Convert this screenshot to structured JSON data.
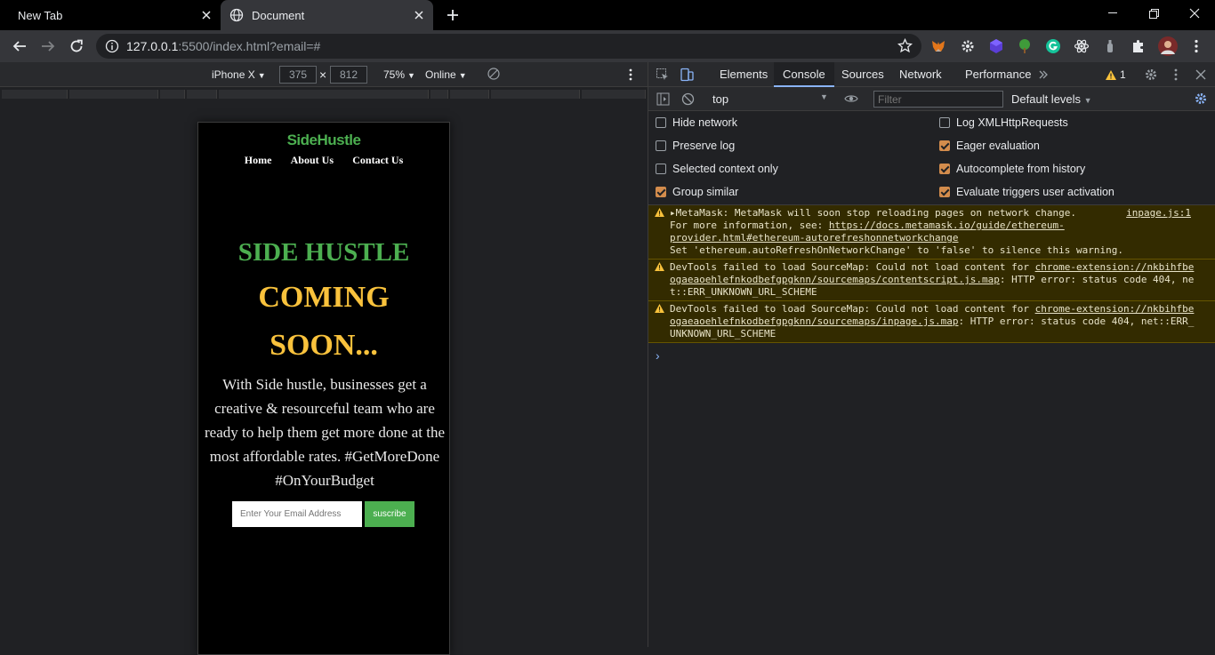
{
  "tabs": [
    {
      "title": "New Tab"
    },
    {
      "title": "Document"
    }
  ],
  "omnibox": {
    "url_host": "127.0.0.1",
    "url_rest": ":5500/index.html?email=#"
  },
  "device_toolbar": {
    "device": "iPhone X",
    "width": "375",
    "height": "812",
    "zoom": "75%",
    "network": "Online"
  },
  "site": {
    "logo": "SideHustle",
    "nav": [
      "Home",
      "About Us",
      "Contact Us"
    ],
    "hero_title": "SIDE HUSTLE",
    "hero_sub1": "COMING",
    "hero_sub2": "SOON...",
    "description": "With Side hustle, businesses get a creative & resourceful team who are ready to help them get more done at the most affordable rates. #GetMoreDone #OnYourBudget",
    "email_placeholder": "Enter Your Email Address",
    "subscribe_label": "suscribe"
  },
  "devtools": {
    "tabs": [
      "Elements",
      "Console",
      "Sources",
      "Network",
      "Performance"
    ],
    "active_tab": "Console",
    "warning_count": "1",
    "context": "top",
    "filter_placeholder": "Filter",
    "levels": "Default levels",
    "settings_left": [
      {
        "label": "Hide network",
        "checked": false
      },
      {
        "label": "Preserve log",
        "checked": false
      },
      {
        "label": "Selected context only",
        "checked": false
      },
      {
        "label": "Group similar",
        "checked": true
      }
    ],
    "settings_right": [
      {
        "label": "Log XMLHttpRequests",
        "checked": false
      },
      {
        "label": "Eager evaluation",
        "checked": true
      },
      {
        "label": "Autocomplete from history",
        "checked": true
      },
      {
        "label": "Evaluate triggers user activation",
        "checked": true
      }
    ],
    "messages": [
      {
        "line1": "▸MetaMask: MetaMask will soon stop reloading pages on network change.",
        "source": "inpage.js:1",
        "line2_prefix": "For more information, see: ",
        "link": "https://docs.metamask.io/guide/ethereum-provider.html#ethereum-autorefreshonnetworkchange",
        "line3": "Set 'ethereum.autoRefreshOnNetworkChange' to 'false' to silence this warning."
      },
      {
        "prefix": "DevTools failed to load SourceMap: Could not load content for ",
        "link": "chrome-extension://nkbihfbeogaeaoehlefnkodbefgpgknn/sourcemaps/contentscript.js.map",
        "suffix": ": HTTP error: status code 404, net::ERR_UNKNOWN_URL_SCHEME"
      },
      {
        "prefix": "DevTools failed to load SourceMap: Could not load content for ",
        "link": "chrome-extension://nkbihfbeogaeaoehlefnkodbefgpgknn/sourcemaps/inpage.js.map",
        "suffix": ": HTTP error: status code 404, net::ERR_UNKNOWN_URL_SCHEME"
      }
    ],
    "prompt": "›"
  }
}
